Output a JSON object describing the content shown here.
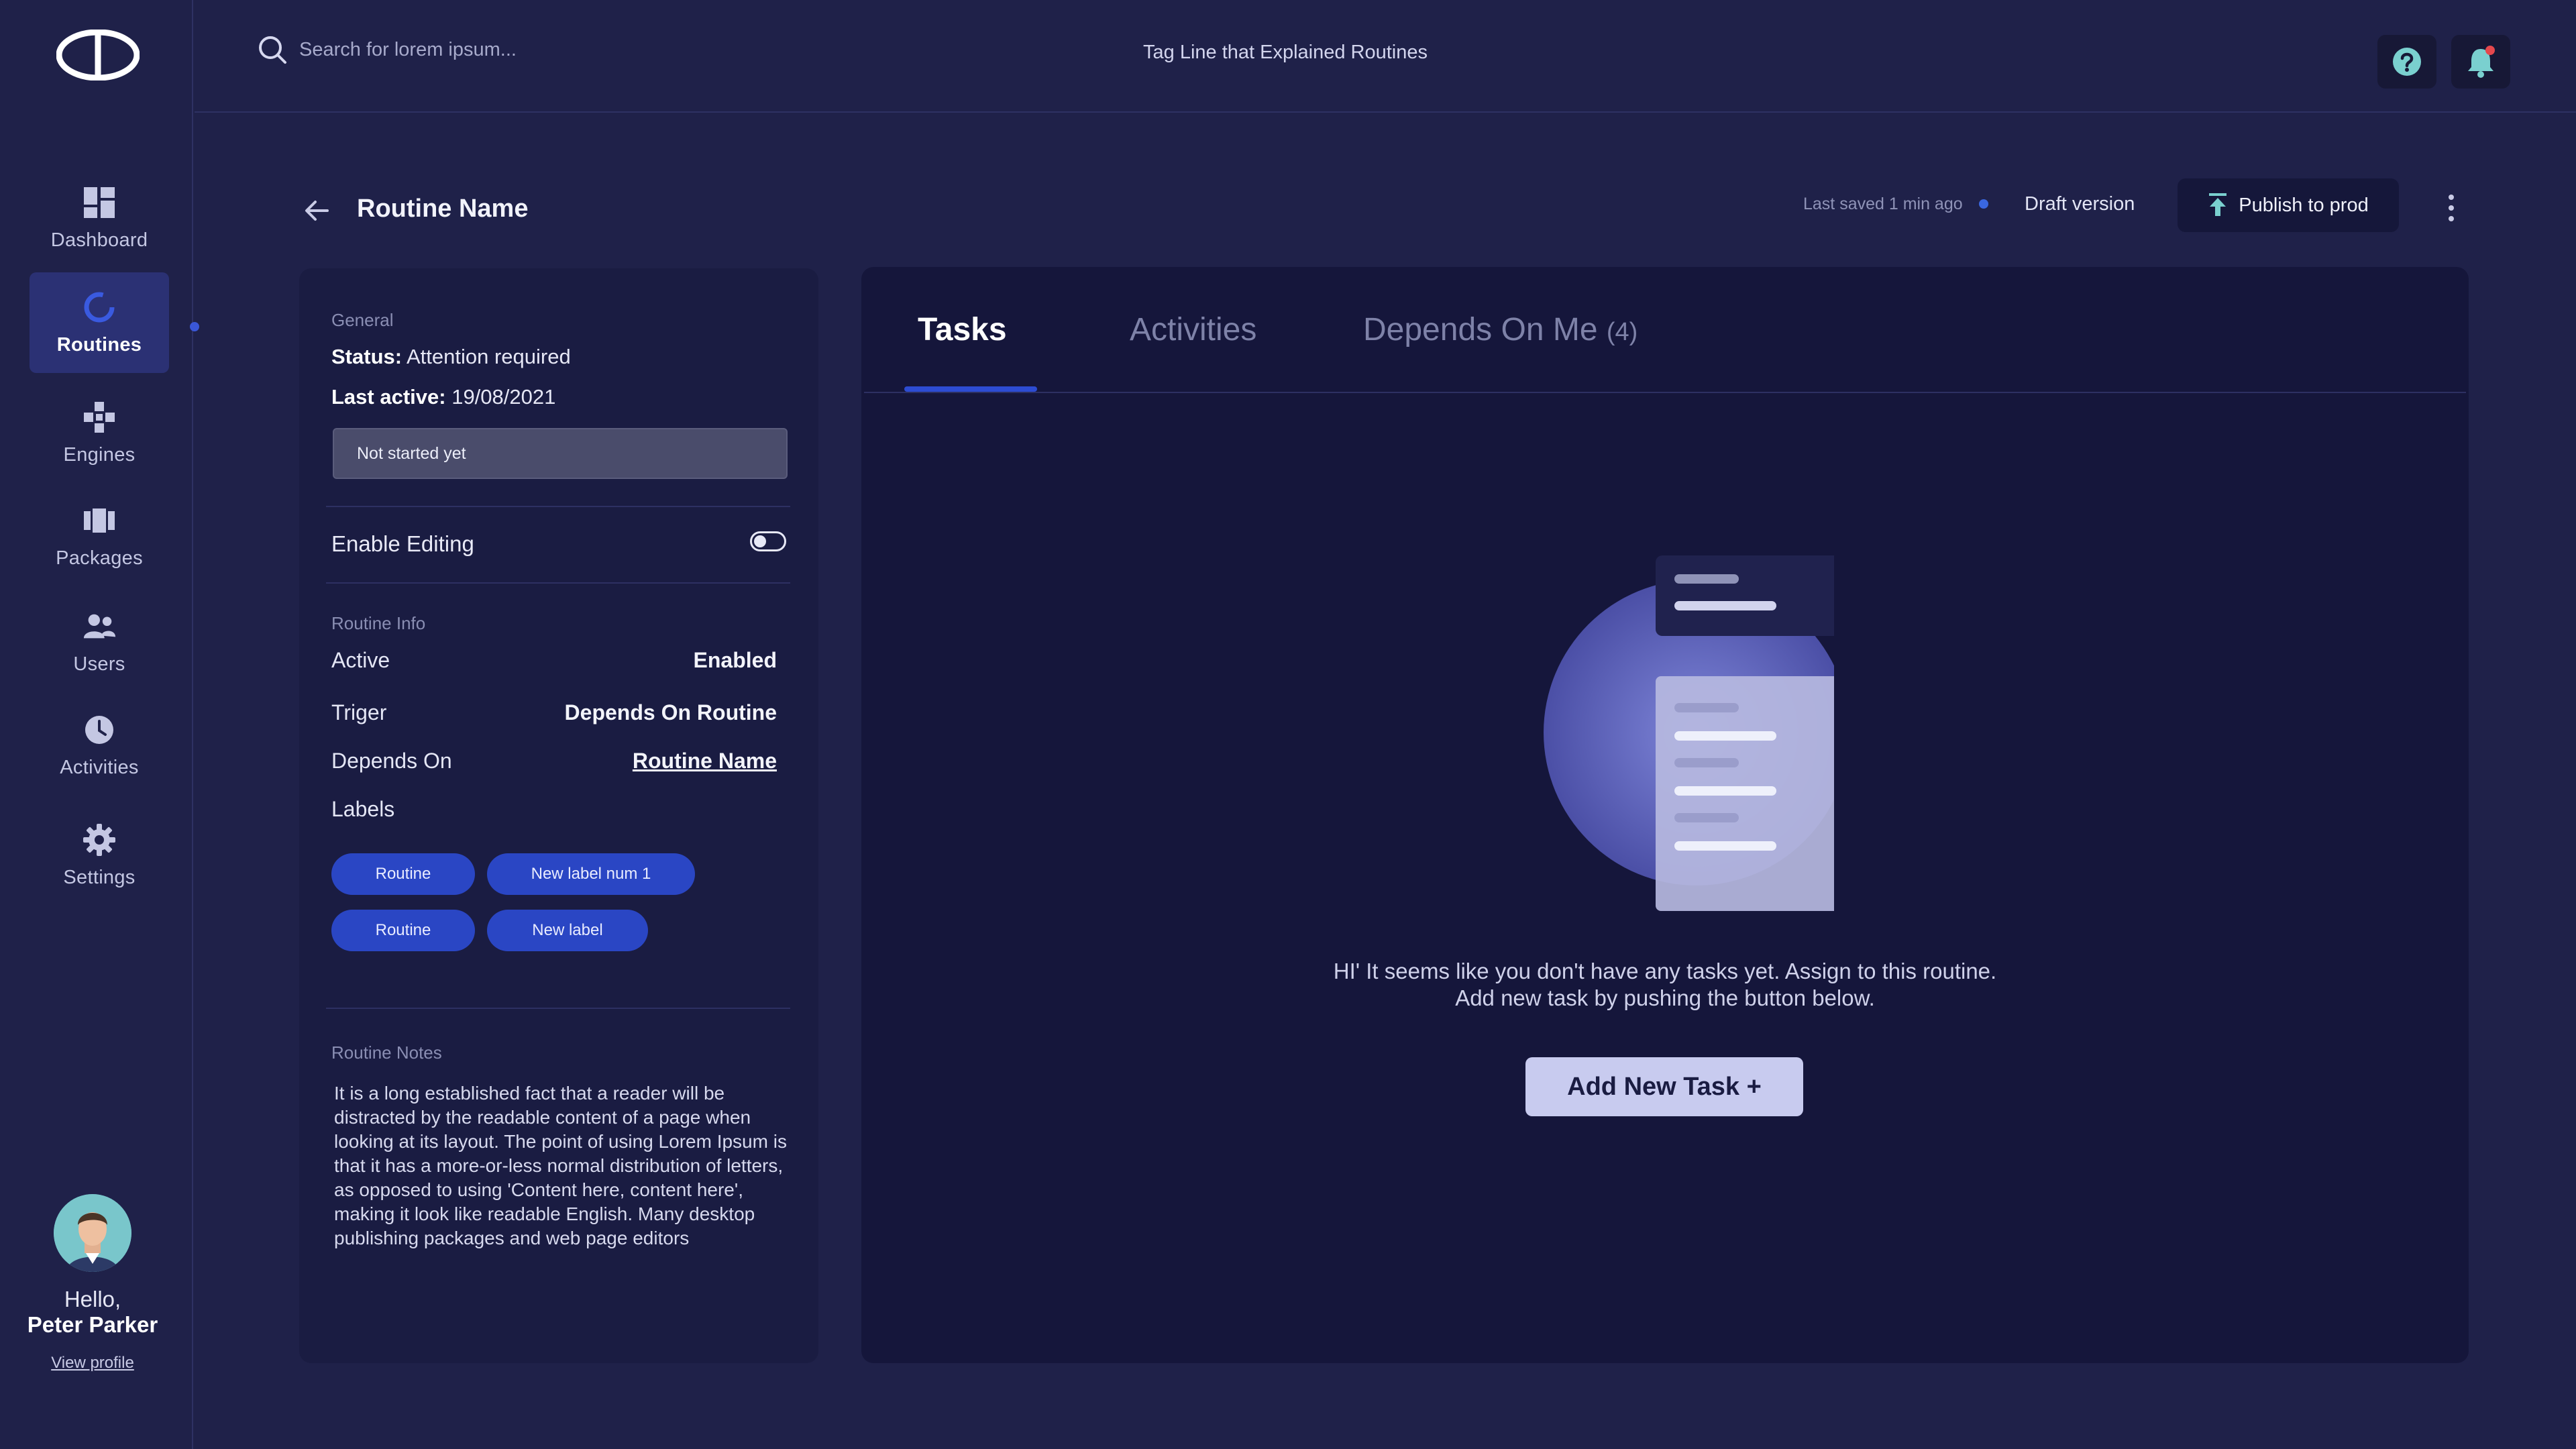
{
  "sidebar": {
    "logo_icon": "app-logo",
    "items": [
      {
        "label": "Dashboard",
        "icon": "grid-icon"
      },
      {
        "label": "Routines",
        "icon": "refresh-ring-icon"
      },
      {
        "label": "Engines",
        "icon": "engine-icon"
      },
      {
        "label": "Packages",
        "icon": "package-icon"
      },
      {
        "label": "Users",
        "icon": "users-icon"
      },
      {
        "label": "Activities",
        "icon": "clock-icon"
      },
      {
        "label": "Settings",
        "icon": "gear-icon"
      }
    ],
    "active_item": "Routines",
    "profile": {
      "greeting": "Hello,",
      "name": "Peter Parker",
      "link": "View profile"
    }
  },
  "topbar": {
    "search_placeholder": "Search for lorem ipsum...",
    "tagline": "Tag Line that Explained Routines"
  },
  "header": {
    "title": "Routine Name",
    "last_saved": "Last saved 1 min ago",
    "version": "Draft version",
    "publish_label": "Publish to prod"
  },
  "info": {
    "general_label": "General",
    "status_key": "Status:",
    "status_value": "Attention required",
    "last_active_key": "Last active:",
    "last_active_value": "19/08/2021",
    "status_select": "Not started yet",
    "enable_editing": "Enable Editing",
    "enable_editing_on": false,
    "routine_info_label": "Routine Info",
    "rows": [
      {
        "label": "Active",
        "value": "Enabled"
      },
      {
        "label": "Triger",
        "value": "Depends On Routine"
      },
      {
        "label": "Depends On",
        "value": "Routine Name"
      }
    ],
    "labels_title": "Labels",
    "labels": [
      "Routine",
      "New label num 1",
      "Routine",
      "New label"
    ],
    "notes_label": "Routine Notes",
    "notes": "It is a long established fact that a reader will be distracted by the readable content of a page when looking at its layout. The point of using Lorem Ipsum is that it has a more-or-less normal distribution of letters, as opposed to using 'Content here, content here', making it look like readable English. Many desktop publishing packages and web page editors"
  },
  "tasks": {
    "tabs": [
      {
        "label": "Tasks"
      },
      {
        "label": "Activities"
      },
      {
        "label": "Depends On Me",
        "count": "(4)"
      }
    ],
    "active_tab": "Tasks",
    "empty_line1": "HI' It seems like you don't have any tasks yet. Assign to this routine.",
    "empty_line2": "Add new task by pushing the button below.",
    "add_button": "Add New Task +"
  },
  "colors": {
    "background": "#1f2149",
    "accent": "#2d4cd2",
    "chip": "#2a46c4",
    "notification_dot": "#e5484d"
  }
}
